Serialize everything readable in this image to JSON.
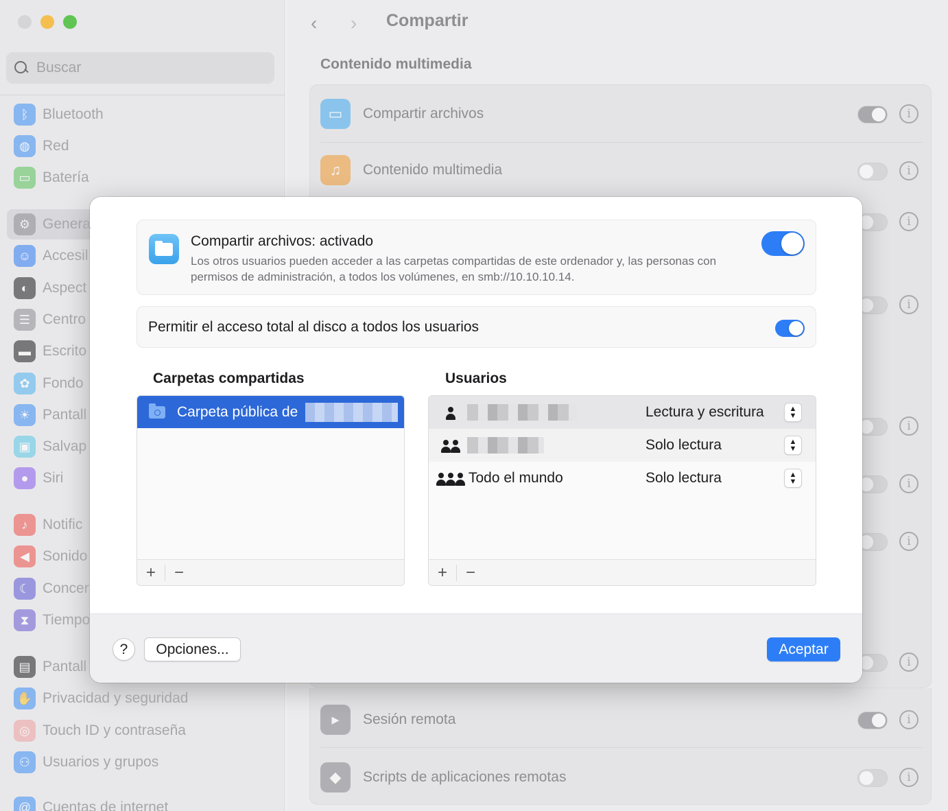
{
  "window": {
    "title": "Compartir"
  },
  "search": {
    "placeholder": "Buscar"
  },
  "sidebar": {
    "items": [
      {
        "label": "Bluetooth",
        "icon": "bluetooth-icon",
        "color": "#3b8ff5"
      },
      {
        "label": "Red",
        "icon": "globe-icon",
        "color": "#3b8ff5"
      },
      {
        "label": "Batería",
        "icon": "battery-icon",
        "color": "#5ac35a"
      },
      {
        "label": "Genera",
        "icon": "gear-icon",
        "color": "#8e8e93",
        "selected": true
      },
      {
        "label": "Accesil",
        "icon": "accessibility-icon",
        "color": "#2f7cf6"
      },
      {
        "label": "Aspect",
        "icon": "appearance-icon",
        "color": "#1d1d1f"
      },
      {
        "label": "Centro",
        "icon": "control-center-icon",
        "color": "#8e8e93"
      },
      {
        "label": "Escrito",
        "icon": "desktop-icon",
        "color": "#1d1d1f"
      },
      {
        "label": "Fondo",
        "icon": "wallpaper-icon",
        "color": "#4fb3f0"
      },
      {
        "label": "Pantall",
        "icon": "display-icon",
        "color": "#3b8ff5"
      },
      {
        "label": "Salvap",
        "icon": "screensaver-icon",
        "color": "#5ac8e8"
      },
      {
        "label": "Siri",
        "icon": "siri-icon",
        "color": "#8a5cf0"
      },
      {
        "label": "Notific",
        "icon": "bell-icon",
        "color": "#f0504a"
      },
      {
        "label": "Sonido",
        "icon": "speaker-icon",
        "color": "#f0504a"
      },
      {
        "label": "Concer",
        "icon": "moon-icon",
        "color": "#5b56d6"
      },
      {
        "label": "Tiempo",
        "icon": "hourglass-icon",
        "color": "#6b5bd6"
      },
      {
        "label": "Pantall",
        "icon": "lock-icon",
        "color": "#1d1d1f"
      },
      {
        "label": "Privacidad y seguridad",
        "icon": "hand-icon",
        "color": "#3b8ff5"
      },
      {
        "label": "Touch ID y contraseña",
        "icon": "fingerprint-icon",
        "color": "#f0a0a0"
      },
      {
        "label": "Usuarios y grupos",
        "icon": "users-icon",
        "color": "#3b8ff5"
      },
      {
        "label": "Cuentas de internet",
        "icon": "at-icon",
        "color": "#3b8ff5"
      }
    ]
  },
  "main": {
    "section_title": "Contenido multimedia",
    "rows": [
      {
        "label": "Compartir archivos",
        "icon": "folder-icon",
        "color": "#4fb0f0",
        "on": true
      },
      {
        "label": "Contenido multimedia",
        "icon": "music-folder-icon",
        "color": "#f0a040",
        "on": false
      },
      {
        "label": "Sesión remota",
        "icon": "terminal-icon",
        "color": "#8e8e93",
        "on": true
      },
      {
        "label": "Scripts de aplicaciones remotas",
        "icon": "script-icon",
        "color": "#8e8e93",
        "on": false
      }
    ]
  },
  "sheet": {
    "file_sharing": {
      "title": "Compartir archivos: activado",
      "description": "Los otros usuarios pueden acceder a las carpetas compartidas de este ordenador y, las personas con permisos de administración, a todos los volúmenes, en smb://10.10.10.14.",
      "enabled": true
    },
    "full_disk": {
      "label": "Permitir el acceso total al disco a todos los usuarios",
      "enabled": true
    },
    "folders": {
      "heading": "Carpetas compartidas",
      "items": [
        {
          "label": "Carpeta pública de"
        }
      ]
    },
    "users": {
      "heading": "Usuarios",
      "items": [
        {
          "name": "",
          "permission": "Lectura y escritura"
        },
        {
          "name": "",
          "permission": "Solo lectura"
        },
        {
          "name": "Todo el mundo",
          "permission": "Solo lectura"
        }
      ]
    },
    "list_controls": {
      "add": "+",
      "remove": "−"
    },
    "footer": {
      "help": "?",
      "options": "Opciones...",
      "accept": "Aceptar"
    }
  },
  "colors": {
    "accent": "#2d7ef6",
    "selection": "#2c68d8"
  }
}
